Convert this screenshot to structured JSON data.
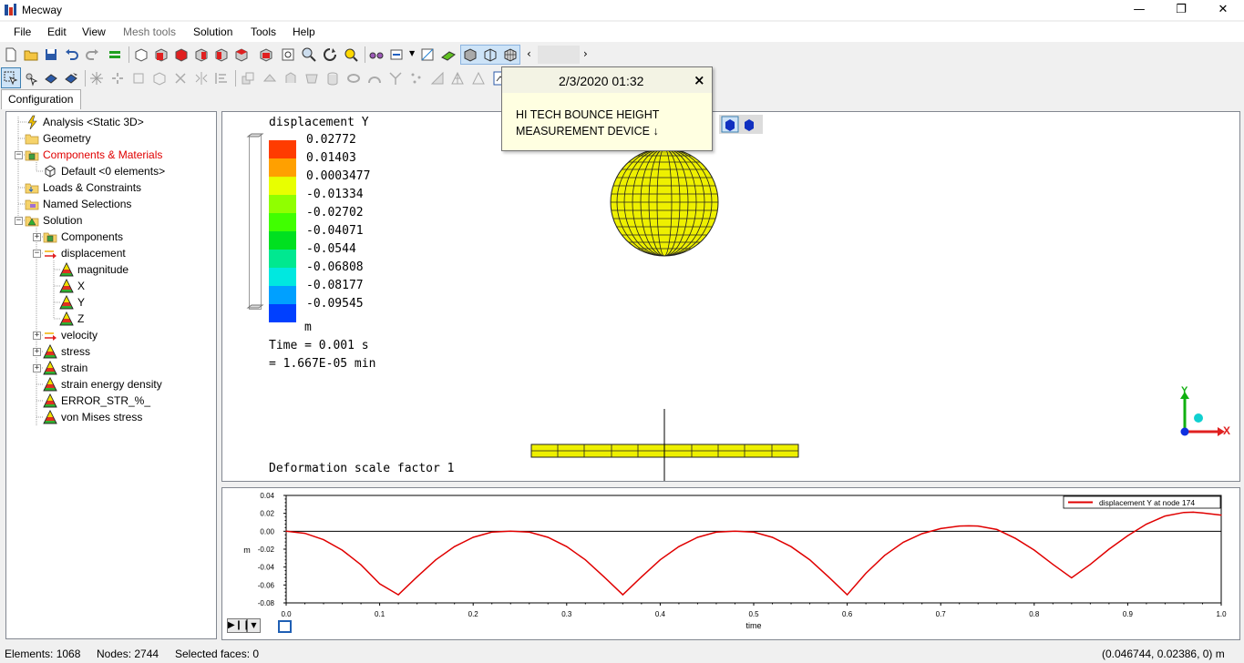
{
  "window": {
    "title": "Mecway",
    "minimize": "—",
    "restore": "❐",
    "close": "✕"
  },
  "menu": [
    {
      "label": "File",
      "disabled": false
    },
    {
      "label": "Edit",
      "disabled": false
    },
    {
      "label": "View",
      "disabled": false
    },
    {
      "label": "Mesh tools",
      "disabled": true
    },
    {
      "label": "Solution",
      "disabled": false
    },
    {
      "label": "Tools",
      "disabled": false
    },
    {
      "label": "Help",
      "disabled": false
    }
  ],
  "tabs": {
    "configuration": "Configuration"
  },
  "tree": [
    {
      "label": "Analysis <Static 3D>",
      "icon": "lightning-icon",
      "red": false
    },
    {
      "label": "Geometry",
      "icon": "folder-icon",
      "red": false
    },
    {
      "label": "Components & Materials",
      "icon": "components-icon",
      "red": true
    },
    {
      "label": "Default <0 elements>",
      "icon": "component-item-icon",
      "red": false
    },
    {
      "label": "Loads & Constraints",
      "icon": "loads-folder-icon",
      "red": false
    },
    {
      "label": "Named Selections",
      "icon": "named-selections-icon",
      "red": false
    },
    {
      "label": "Solution",
      "icon": "solution-icon",
      "red": false
    },
    {
      "label": "Components",
      "icon": "components-icon",
      "red": false
    },
    {
      "label": "displacement",
      "icon": "vector-arrow-icon",
      "red": false
    },
    {
      "label": "magnitude",
      "icon": "contour-triangle-icon",
      "red": false
    },
    {
      "label": "X",
      "icon": "contour-triangle-icon",
      "red": false
    },
    {
      "label": "Y",
      "icon": "contour-triangle-icon",
      "red": false
    },
    {
      "label": "Z",
      "icon": "contour-triangle-icon",
      "red": false
    },
    {
      "label": "velocity",
      "icon": "vector-arrow-icon",
      "red": false
    },
    {
      "label": "stress",
      "icon": "contour-triangle-icon",
      "red": false
    },
    {
      "label": "strain",
      "icon": "contour-triangle-icon",
      "red": false
    },
    {
      "label": "strain energy density",
      "icon": "contour-triangle-icon",
      "red": false
    },
    {
      "label": "ERROR_STR_%_",
      "icon": "contour-triangle-icon",
      "red": false
    },
    {
      "label": "von Mises stress",
      "icon": "contour-triangle-icon",
      "red": false
    }
  ],
  "viewport": {
    "result_title": "displacement Y",
    "legend": [
      {
        "value": "0.02772",
        "color": "#ff3c00"
      },
      {
        "value": "0.01403",
        "color": "#ffa000"
      },
      {
        "value": "0.0003477",
        "color": "#e8ff00"
      },
      {
        "value": "-0.01334",
        "color": "#90ff00"
      },
      {
        "value": "-0.02702",
        "color": "#40ff00"
      },
      {
        "value": "-0.04071",
        "color": "#00e020"
      },
      {
        "value": "-0.0544",
        "color": "#00e890"
      },
      {
        "value": "-0.06808",
        "color": "#00e8e0"
      },
      {
        "value": "-0.08177",
        "color": "#00a0ff"
      },
      {
        "value": "-0.09545",
        "color": "#0040ff"
      }
    ],
    "unit": "m",
    "time_line1": "Time = 0.001 s",
    "time_line2": "= 1.667E-05 min",
    "scale_factor": "Deformation scale factor 1",
    "axis_y": "Y",
    "axis_x": "X"
  },
  "tooltip": {
    "title": "2/3/2020 01:32",
    "close": "×",
    "body_line1": "HI TECH BOUNCE HEIGHT",
    "body_line2": "MEASUREMENT DEVICE ↓"
  },
  "chart_data": {
    "type": "line",
    "series": [
      {
        "name": "displacement Y at node 174",
        "color": "#e00000",
        "x": [
          0.0,
          0.02,
          0.04,
          0.06,
          0.08,
          0.1,
          0.12,
          0.14,
          0.16,
          0.18,
          0.2,
          0.22,
          0.24,
          0.26,
          0.28,
          0.3,
          0.32,
          0.34,
          0.36,
          0.38,
          0.4,
          0.42,
          0.44,
          0.46,
          0.48,
          0.5,
          0.52,
          0.54,
          0.56,
          0.58,
          0.6,
          0.62,
          0.64,
          0.66,
          0.68,
          0.7,
          0.72,
          0.73,
          0.74,
          0.76,
          0.78,
          0.8,
          0.82,
          0.84,
          0.86,
          0.88,
          0.9,
          0.92,
          0.94,
          0.96,
          0.97,
          0.98,
          1.0
        ],
        "y": [
          0.0,
          -0.0023,
          -0.0094,
          -0.0211,
          -0.0375,
          -0.0586,
          -0.071,
          -0.0509,
          -0.0319,
          -0.0172,
          -0.0068,
          -0.001,
          0.0,
          -0.001,
          -0.0068,
          -0.0172,
          -0.0319,
          -0.0509,
          -0.071,
          -0.0509,
          -0.0319,
          -0.0172,
          -0.0068,
          -0.001,
          0.0,
          -0.001,
          -0.0068,
          -0.0172,
          -0.0319,
          -0.0509,
          -0.071,
          -0.047,
          -0.027,
          -0.0123,
          -0.0027,
          0.003,
          0.0058,
          0.006,
          0.0058,
          0.002,
          -0.008,
          -0.021,
          -0.037,
          -0.052,
          -0.037,
          -0.02,
          -0.005,
          0.008,
          0.017,
          0.021,
          0.0213,
          0.0205,
          0.018
        ]
      }
    ],
    "xlabel": "time",
    "ylabel": "m",
    "xlim": [
      0.0,
      1.0
    ],
    "ylim": [
      -0.08,
      0.04
    ],
    "xticks": [
      "0.0",
      "0.1",
      "0.2",
      "0.3",
      "0.4",
      "0.5",
      "0.6",
      "0.7",
      "0.8",
      "0.9",
      "1.0"
    ],
    "yticks": [
      "0.04",
      "0.02",
      "0.00",
      "-0.02",
      "-0.04",
      "-0.06",
      "-0.08"
    ],
    "legend_position": "top-right"
  },
  "player": {
    "play_label": "▶❙❙",
    "drop_label": "▼"
  },
  "status": {
    "elements": "Elements: 1068",
    "nodes": "Nodes: 2744",
    "selected": "Selected faces: 0",
    "coords": "(0.046744, 0.02386, 0) m"
  }
}
